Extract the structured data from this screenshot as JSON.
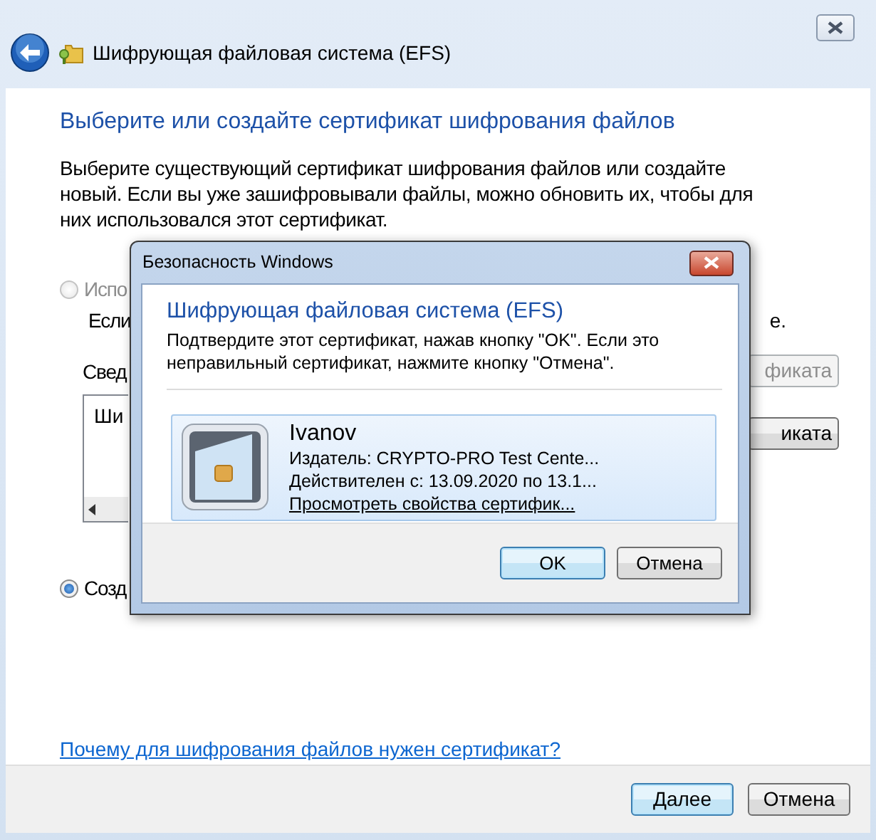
{
  "window": {
    "title": "Шифрующая файловая система (EFS)"
  },
  "heading": "Выберите или создайте сертификат шифрования файлов",
  "intro": "Выберите существующий сертификат шифрования файлов или создайте новый. Если вы уже зашифровывали файлы, можно обновить их, чтобы для них использовался этот сертификат.",
  "options": [
    {
      "label": "Испо",
      "selected": false,
      "disabled": true
    },
    {
      "label": "Созд",
      "selected": true,
      "disabled": false
    }
  ],
  "option_note": {
    "start": "Если",
    "end": "е."
  },
  "details_label": "Свед",
  "cert_list": {
    "items": [
      "Ши"
    ]
  },
  "side_buttons": [
    {
      "label": "фиката",
      "disabled": true
    },
    {
      "label": "иката",
      "disabled": false
    }
  ],
  "help_link": "Почему для шифрования файлов нужен сертификат?",
  "buttons": [
    {
      "label": "Далее",
      "default": true
    },
    {
      "label": "Отмена",
      "default": false
    }
  ],
  "dialog": {
    "title": "Безопасность Windows",
    "heading": "Шифрующая файловая система (EFS)",
    "message": "Подтвердите этот сертификат, нажав кнопку \"OK\". Если это неправильный сертификат, нажмите кнопку \"Отмена\".",
    "certificate": {
      "name": "Ivanov",
      "issuer": "Издатель: CRYPTO-PRO Test Cente...",
      "validity": "Действителен с: 13.09.2020 по 13.1...",
      "link": "Просмотреть свойства сертифик..."
    },
    "buttons": [
      {
        "label": "OK",
        "default": true
      },
      {
        "label": "Отмена",
        "default": false
      }
    ]
  }
}
